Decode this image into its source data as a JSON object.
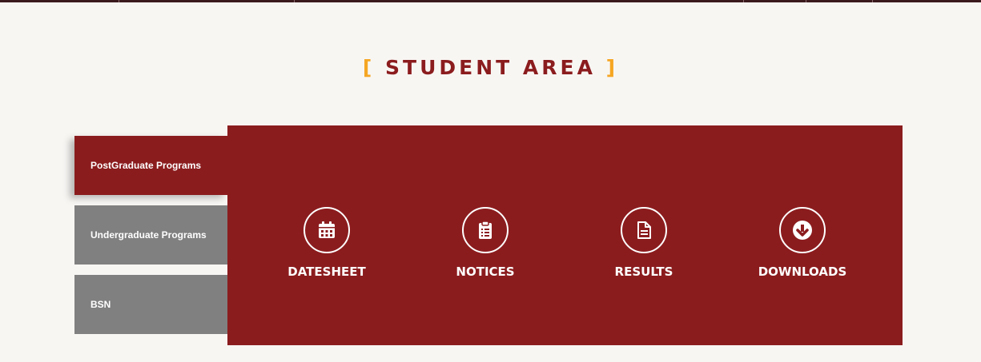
{
  "section": {
    "bracket_left": "[",
    "title": "STUDENT AREA",
    "bracket_right": "]"
  },
  "tabs": [
    {
      "label": "PostGraduate Programs",
      "active": true
    },
    {
      "label": "Undergraduate Programs",
      "active": false
    },
    {
      "label": "BSN",
      "active": false
    }
  ],
  "items": [
    {
      "label": "DATESHEET",
      "icon": "calendar-icon"
    },
    {
      "label": "NOTICES",
      "icon": "clipboard-icon"
    },
    {
      "label": "RESULTS",
      "icon": "document-icon"
    },
    {
      "label": "DOWNLOADS",
      "icon": "download-icon"
    }
  ],
  "colors": {
    "primary": "#8b1c1e",
    "accent": "#f5a623",
    "inactive_tab": "#808080",
    "background": "#f8f6f3"
  }
}
